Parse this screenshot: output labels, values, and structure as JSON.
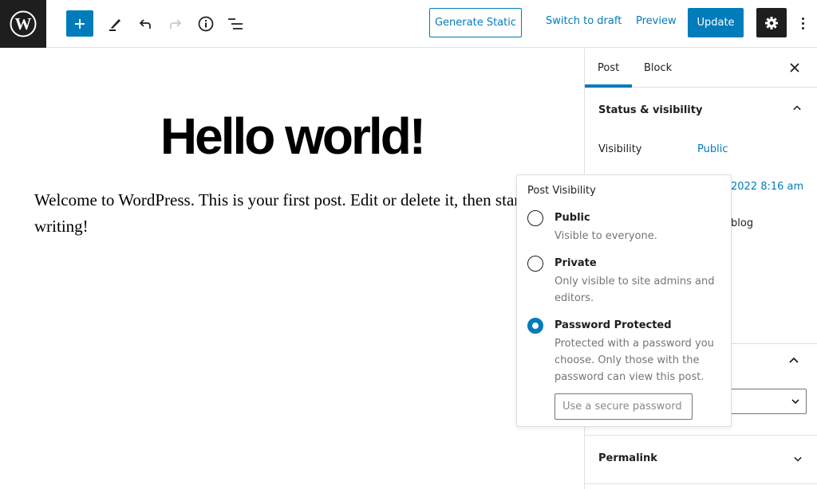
{
  "toolbar": {
    "logo": "wordpress-logo",
    "add_block": "+",
    "generate_static": "Generate Static",
    "switch_to_draft": "Switch to draft",
    "preview": "Preview",
    "update": "Update",
    "icons": [
      "wordpress-icon",
      "plus-icon",
      "pencil-icon",
      "undo-icon",
      "redo-icon",
      "info-icon",
      "list-view-icon",
      "gear-icon",
      "more-vertical-icon"
    ]
  },
  "editor": {
    "title": "Hello world!",
    "body": "Welcome to WordPress. This is your first post. Edit or delete it, then start writing!"
  },
  "sidebar": {
    "tabs": [
      {
        "label": "Post",
        "active": true
      },
      {
        "label": "Block",
        "active": false
      }
    ],
    "status_panel": {
      "title": "Status & visibility",
      "visibility_label": "Visibility",
      "visibility_value": "Public",
      "publish_value": "2022 8:16 am",
      "partial_text": "blog"
    },
    "permalink_panel": {
      "title": "Permalink"
    }
  },
  "popover": {
    "title": "Post Visibility",
    "options": [
      {
        "label": "Public",
        "description": "Visible to everyone.",
        "checked": false
      },
      {
        "label": "Private",
        "description": "Only visible to site admins and editors.",
        "checked": false
      },
      {
        "label": "Password Protected",
        "description": "Protected with a password you choose. Only those with the password can view this post.",
        "checked": true
      }
    ],
    "password_placeholder": "Use a secure password",
    "password_value": ""
  },
  "colors": {
    "accent": "#007cba",
    "dark": "#1e1e1e",
    "muted": "#757575"
  }
}
